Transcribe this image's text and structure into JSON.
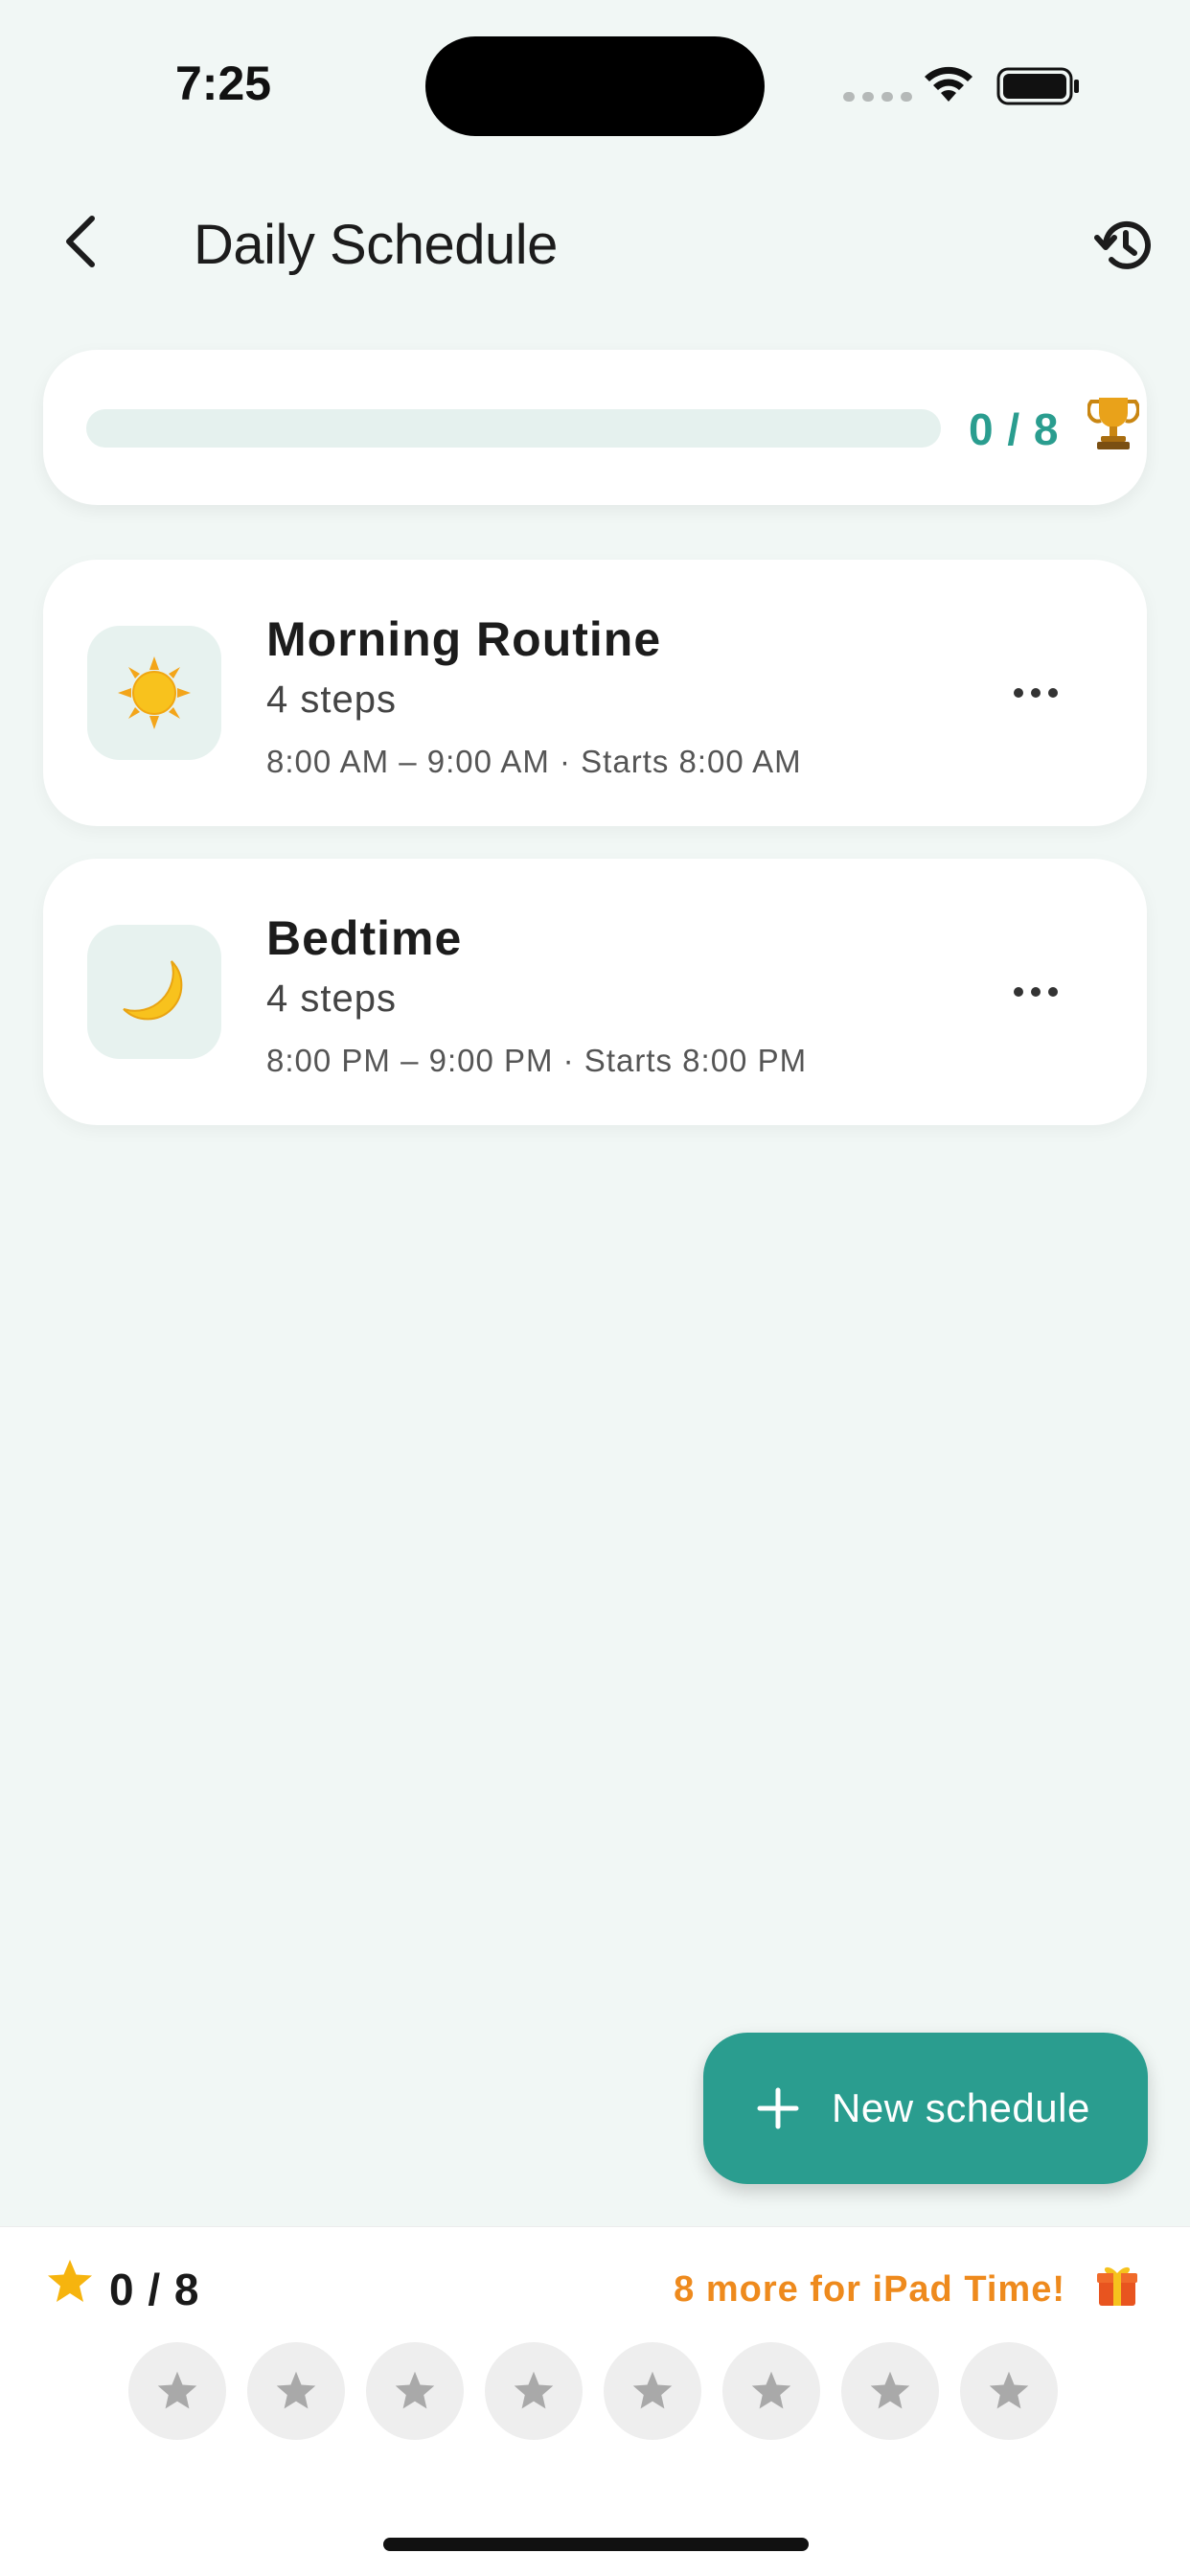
{
  "status_bar": {
    "time": "7:25"
  },
  "header": {
    "title": "Daily Schedule"
  },
  "progress": {
    "completed": 0,
    "total": 8,
    "label": "0 / 8"
  },
  "schedules": [
    {
      "title": "Morning Routine",
      "steps": "4 steps",
      "time": "8:00 AM – 9:00 AM · Starts 8:00 AM",
      "icon": "sun-icon"
    },
    {
      "title": "Bedtime",
      "steps": "4 steps",
      "time": "8:00 PM – 9:00 PM · Starts 8:00 PM",
      "icon": "moon-icon"
    }
  ],
  "fab": {
    "label": "New schedule"
  },
  "rewards": {
    "count_label": "0 / 8",
    "earned": 0,
    "total": 8,
    "message": "8 more for iPad Time!"
  },
  "colors": {
    "accent": "#2a9d8f",
    "reward_text": "#ee8a1d",
    "star_gold": "#f6b40e",
    "background": "#f1f7f5"
  }
}
